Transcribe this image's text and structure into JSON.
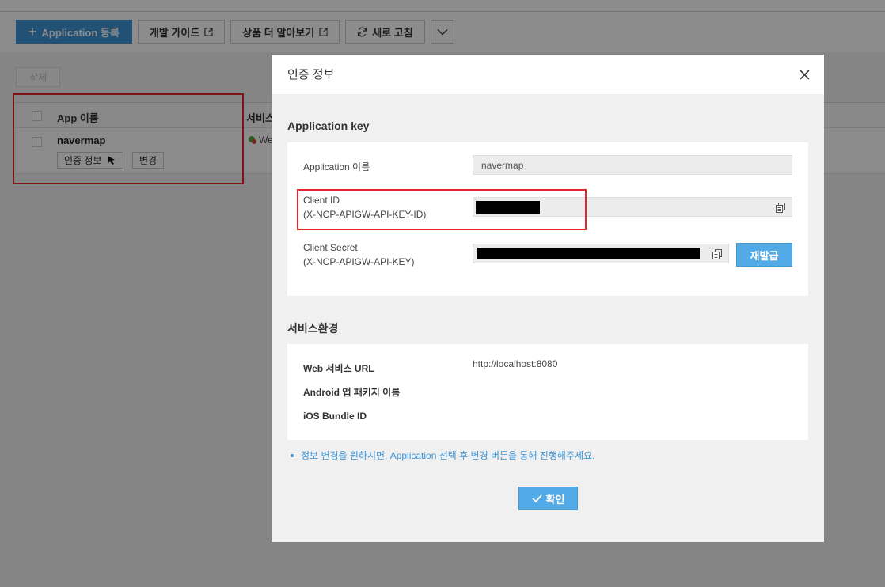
{
  "toolbar": {
    "register_label": "Application 등록",
    "register_icon": "plus-icon",
    "guide_label": "개발 가이드",
    "product_label": "상품 더 알아보기",
    "refresh_label": "새로 고침",
    "external_icon": "external-link-icon",
    "refresh_icon": "refresh-icon",
    "more_icon": "chevron-down-icon"
  },
  "list": {
    "delete_label": "삭제",
    "col_app_name": "App 이름",
    "col_service": "서비스",
    "rows": [
      {
        "name": "navermap",
        "auth_button": "인증 정보",
        "change_button": "변경",
        "service_partial": "We"
      }
    ]
  },
  "modal": {
    "title": "인증 정보",
    "close_icon": "close-icon",
    "app_key_section": "Application key",
    "app_name_label": "Application 이름",
    "app_name_value": "navermap",
    "client_id_label": "Client ID",
    "client_id_sub": "(X-NCP-APIGW-API-KEY-ID)",
    "client_secret_label": "Client Secret",
    "client_secret_sub": "(X-NCP-APIGW-API-KEY)",
    "reissue_label": "재발급",
    "copy_icon": "copy-icon",
    "service_section": "서비스환경",
    "web_url_label": "Web 서비스 URL",
    "web_url_value": "http://localhost:8080",
    "android_label": "Android 앱 패키지 이름",
    "ios_label": "iOS Bundle ID",
    "note": "정보 변경을 원하시면, Application 선택 후 변경 버튼을 통해 진행해주세요.",
    "confirm_label": "확인",
    "confirm_icon": "check-icon"
  },
  "colors": {
    "primary": "#3c95d7",
    "button_blue": "#52abe7",
    "highlight_red": "#e8262a",
    "overlay": "rgba(0,0,0,0.45)"
  }
}
